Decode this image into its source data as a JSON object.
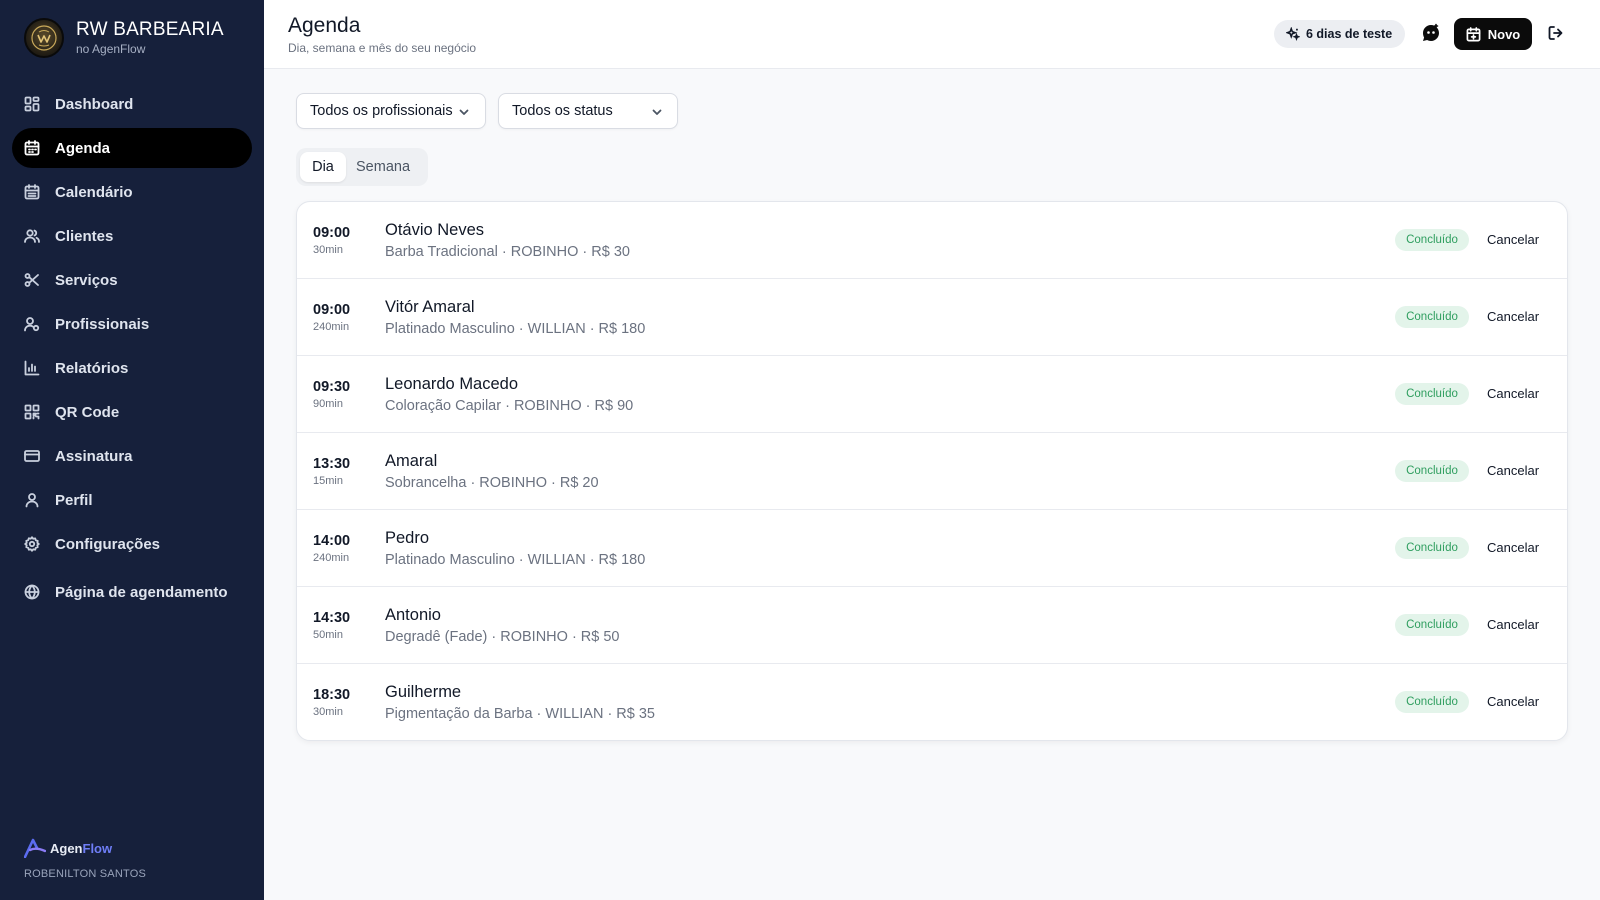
{
  "sidebar": {
    "brand_name": "RW BARBEARIA",
    "brand_sub": "no AgenFlow",
    "items": [
      {
        "label": "Dashboard",
        "icon": "dashboard-icon"
      },
      {
        "label": "Agenda",
        "icon": "calendar-icon",
        "active": true
      },
      {
        "label": "Calendário",
        "icon": "calendar-grid-icon"
      },
      {
        "label": "Clientes",
        "icon": "users-icon"
      },
      {
        "label": "Serviços",
        "icon": "scissors-icon"
      },
      {
        "label": "Profissionais",
        "icon": "professional-icon"
      },
      {
        "label": "Relatórios",
        "icon": "bar-chart-icon"
      },
      {
        "label": "QR Code",
        "icon": "qr-code-icon"
      },
      {
        "label": "Assinatura",
        "icon": "credit-card-icon"
      },
      {
        "label": "Perfil",
        "icon": "user-icon"
      },
      {
        "label": "Configurações",
        "icon": "gear-icon"
      }
    ],
    "booking_page": {
      "label": "Página de agendamento",
      "icon": "globe-icon"
    },
    "footer": {
      "logo_part1": "Agen",
      "logo_part2": "Flow",
      "owner": "ROBENILTON SANTOS"
    }
  },
  "header": {
    "title": "Agenda",
    "subtitle": "Dia, semana e mês do seu negócio",
    "trial_label": "6 dias de teste",
    "new_label": "Novo"
  },
  "filters": {
    "professional": "Todos os profissionais",
    "status": "Todos os status"
  },
  "tabs": [
    {
      "label": "Dia",
      "active": true
    },
    {
      "label": "Semana",
      "active": false
    }
  ],
  "appointments": [
    {
      "time": "09:00",
      "duration": "30min",
      "client": "Otávio Neves",
      "details": "Barba Tradicional · ROBINHO · R$ 30",
      "status": "Concluído",
      "action": "Cancelar"
    },
    {
      "time": "09:00",
      "duration": "240min",
      "client": "Vitór Amaral",
      "details": "Platinado Masculino · WILLIAN · R$ 180",
      "status": "Concluído",
      "action": "Cancelar"
    },
    {
      "time": "09:30",
      "duration": "90min",
      "client": "Leonardo Macedo",
      "details": "Coloração Capilar · ROBINHO · R$ 90",
      "status": "Concluído",
      "action": "Cancelar"
    },
    {
      "time": "13:30",
      "duration": "15min",
      "client": "Amaral",
      "details": "Sobrancelha · ROBINHO · R$ 20",
      "status": "Concluído",
      "action": "Cancelar"
    },
    {
      "time": "14:00",
      "duration": "240min",
      "client": "Pedro",
      "details": "Platinado Masculino · WILLIAN · R$ 180",
      "status": "Concluído",
      "action": "Cancelar"
    },
    {
      "time": "14:30",
      "duration": "50min",
      "client": "Antonio",
      "details": "Degradê (Fade) · ROBINHO · R$ 50",
      "status": "Concluído",
      "action": "Cancelar"
    },
    {
      "time": "18:30",
      "duration": "30min",
      "client": "Guilherme",
      "details": "Pigmentação da Barba · WILLIAN · R$ 35",
      "status": "Concluído",
      "action": "Cancelar"
    }
  ],
  "colors": {
    "sidebar_bg": "#16203b",
    "active_item_bg": "#000000",
    "badge_bg": "#e3f4ea",
    "badge_text": "#2f9e5f",
    "brand_accent": "#6f7ef7"
  }
}
